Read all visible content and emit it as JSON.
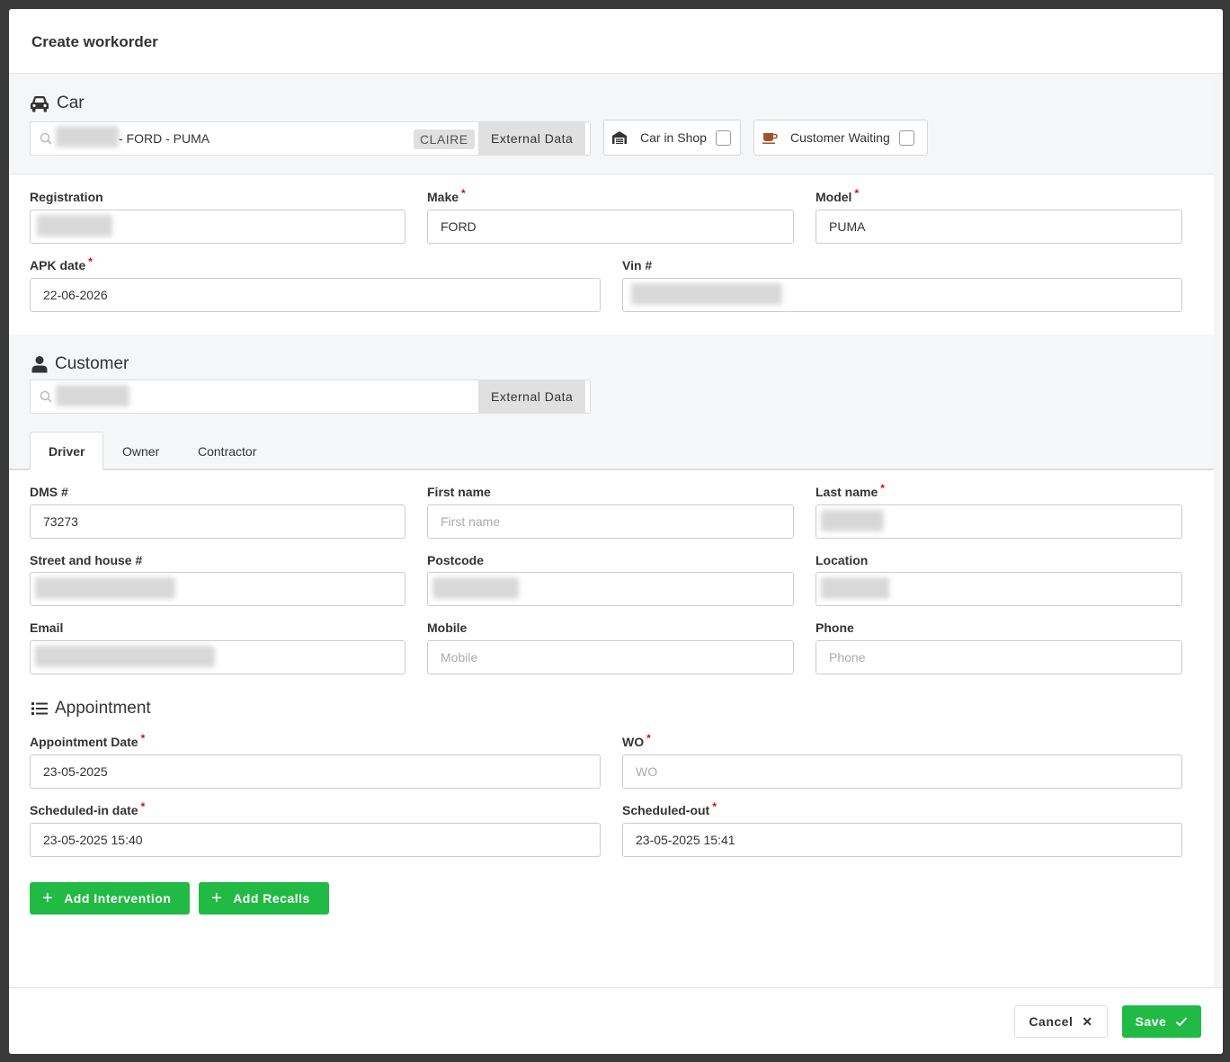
{
  "modal": {
    "title": "Create workorder"
  },
  "car": {
    "section_title": "Car",
    "search_value": "- FORD - PUMA",
    "tag": "CLAIRE",
    "external_label": "External Data",
    "car_in_shop_label": "Car in Shop",
    "customer_waiting_label": "Customer Waiting",
    "fields": {
      "registration_label": "Registration",
      "registration_value": "",
      "make_label": "Make",
      "make_value": "FORD",
      "model_label": "Model",
      "model_value": "PUMA",
      "apk_label": "APK date",
      "apk_value": "22-06-2026",
      "vin_label": "Vin #",
      "vin_value": ""
    }
  },
  "customer": {
    "section_title": "Customer",
    "external_label": "External Data",
    "tabs": [
      "Driver",
      "Owner",
      "Contractor"
    ],
    "fields": {
      "dms_label": "DMS #",
      "dms_value": "73273",
      "first_name_label": "First name",
      "first_name_placeholder": "First name",
      "last_name_label": "Last name",
      "street_label": "Street and house #",
      "postcode_label": "Postcode",
      "location_label": "Location",
      "email_label": "Email",
      "mobile_label": "Mobile",
      "mobile_placeholder": "Mobile",
      "phone_label": "Phone",
      "phone_placeholder": "Phone"
    }
  },
  "appointment": {
    "section_title": "Appointment",
    "date_label": "Appointment Date",
    "date_value": "23-05-2025",
    "wo_label": "WO",
    "wo_placeholder": "WO",
    "scheduled_in_label": "Scheduled-in date",
    "scheduled_in_value": "23-05-2025 15:40",
    "scheduled_out_label": "Scheduled-out",
    "scheduled_out_value": "23-05-2025 15:41",
    "add_intervention_label": "Add Intervention",
    "add_recalls_label": "Add Recalls"
  },
  "footer": {
    "cancel_label": "Cancel",
    "save_label": "Save"
  },
  "colors": {
    "accent_green": "#21ba45",
    "required_red": "#e00000",
    "coffee_brown": "#a0522d"
  }
}
